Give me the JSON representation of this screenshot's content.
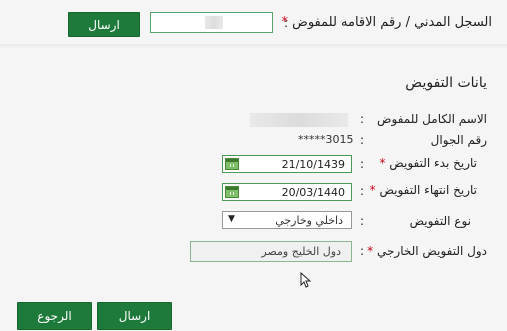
{
  "header": {
    "national_id_label": "السجل المدني / رقم الاقامه للمفوض",
    "required_mark": "*",
    "colon": ":",
    "send_button": "ارسال"
  },
  "section": {
    "title": "يانات التفويض"
  },
  "fields": {
    "full_name_label": "الاسم الكامل للمفوض",
    "mobile_label": "رقم الجوال",
    "mobile_value": "*****3015",
    "start_date_label": "تاريخ بدء التفويض",
    "start_date_value": "21/10/1439",
    "end_date_label": "تاريخ انتهاء التفويض",
    "end_date_value": "20/03/1440",
    "type_label": "نوع التفويض",
    "type_value": "داخلي وخارجي",
    "countries_label": "دول التفويض الخارجي",
    "countries_value": "دول الخليج ومصر",
    "colon": ":",
    "required_mark": "*"
  },
  "footer": {
    "send_button": "ارسال",
    "back_button": "الرجوع"
  },
  "colors": {
    "button_green": "#1e7a3a",
    "input_border": "#4c9a5a",
    "required": "#d0021b"
  }
}
